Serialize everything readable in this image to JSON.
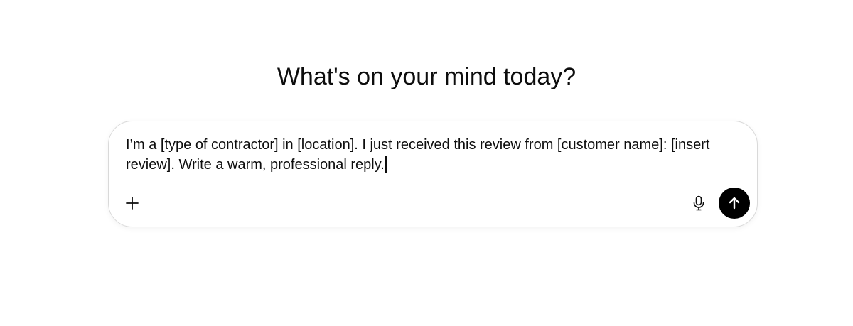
{
  "heading": "What's on your mind today?",
  "composer": {
    "text": "I’m a [type of contractor] in [location]. I just received this review from [customer name]: [insert review]. Write a warm, professional reply.",
    "add_icon": "plus-icon",
    "mic_icon": "microphone-icon",
    "send_icon": "arrow-up-icon",
    "send_color": "#000000"
  }
}
